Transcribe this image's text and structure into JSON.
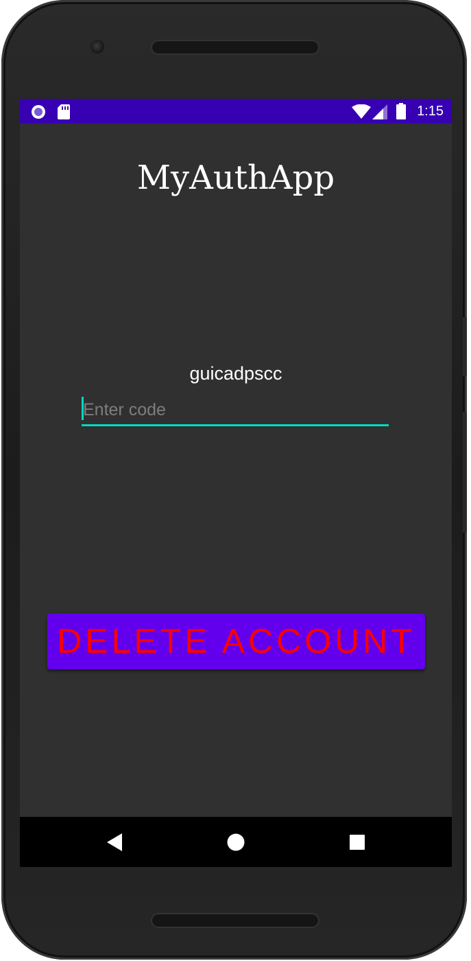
{
  "status_bar": {
    "time": "1:15",
    "left_icons": [
      "circle-notification-icon",
      "sd-card-icon"
    ],
    "right_icons": [
      "wifi-icon",
      "cell-signal-icon",
      "battery-icon"
    ],
    "background": "#3700b3"
  },
  "app": {
    "title": "MyAuthApp",
    "code_label": "guicadpscc",
    "code_input": {
      "value": "",
      "placeholder": "Enter code"
    },
    "delete_button_label": "DELETE ACCOUNT",
    "colors": {
      "background": "#303030",
      "accent": "#03dac5",
      "button_bg": "#6200ee",
      "button_text": "#ff0000"
    }
  },
  "nav_bar": {
    "buttons": [
      "back-icon",
      "home-icon",
      "recents-icon"
    ]
  }
}
